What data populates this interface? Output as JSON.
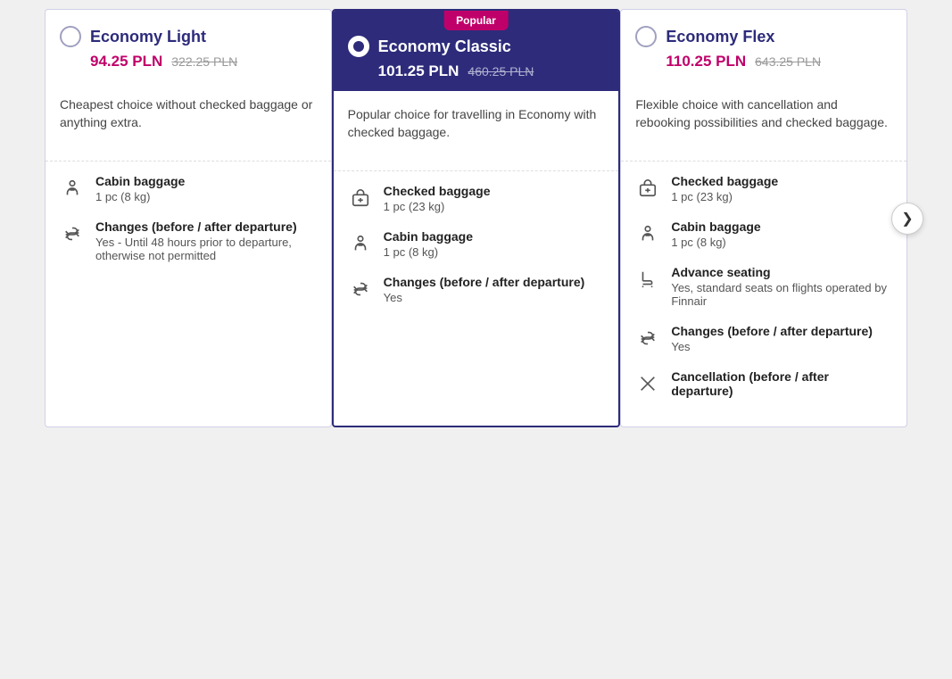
{
  "cards": [
    {
      "id": "light",
      "name": "Economy Light",
      "price_current": "94.25 PLN",
      "price_original": "322.25 PLN",
      "is_popular": false,
      "is_selected": false,
      "description": "Cheapest choice without checked baggage or anything extra.",
      "features": [
        {
          "icon": "person",
          "title": "Cabin baggage",
          "detail": "1 pc (8 kg)"
        },
        {
          "icon": "changes",
          "title": "Changes (before / after departure)",
          "detail": "Yes - Until 48 hours prior to departure, otherwise not permitted"
        }
      ]
    },
    {
      "id": "classic",
      "name": "Economy Classic",
      "price_current": "101.25 PLN",
      "price_original": "460.25 PLN",
      "is_popular": true,
      "is_selected": true,
      "popular_label": "Popular",
      "description": "Popular choice for travelling in Economy with checked baggage.",
      "features": [
        {
          "icon": "suitcase",
          "title": "Checked baggage",
          "detail": "1 pc (23 kg)"
        },
        {
          "icon": "person",
          "title": "Cabin baggage",
          "detail": "1 pc (8 kg)"
        },
        {
          "icon": "changes",
          "title": "Changes (before / after departure)",
          "detail": "Yes"
        }
      ]
    },
    {
      "id": "flex",
      "name": "Economy Flex",
      "price_current": "110.25 PLN",
      "price_original": "643.25 PLN",
      "is_popular": false,
      "is_selected": false,
      "description": "Flexible choice with cancellation and rebooking possibilities and checked baggage.",
      "features": [
        {
          "icon": "suitcase",
          "title": "Checked baggage",
          "detail": "1 pc (23 kg)"
        },
        {
          "icon": "person",
          "title": "Cabin baggage",
          "detail": "1 pc (8 kg)"
        },
        {
          "icon": "seat",
          "title": "Advance seating",
          "detail": "Yes, standard seats on flights operated by Finnair"
        },
        {
          "icon": "changes",
          "title": "Changes (before / after departure)",
          "detail": "Yes"
        },
        {
          "icon": "cancel",
          "title": "Cancellation (before / after departure)",
          "detail": ""
        }
      ]
    }
  ],
  "nav": {
    "next_arrow": "❯"
  }
}
